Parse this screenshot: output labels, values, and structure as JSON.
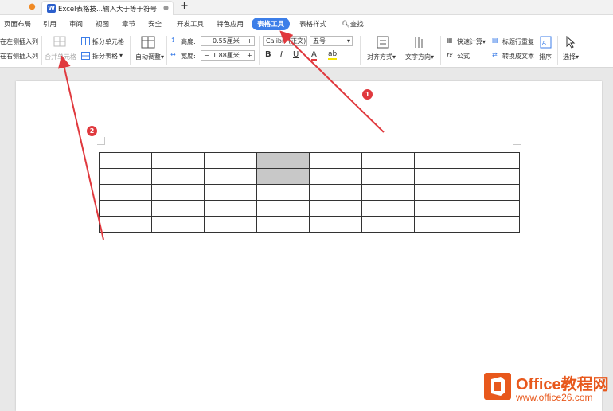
{
  "tabbar": {
    "doc_title": "Excel表格技...输入大于等于符号",
    "new_tab": "+",
    "app_letter": "W"
  },
  "menu": {
    "items": [
      "页面布局",
      "引用",
      "审阅",
      "视图",
      "章节",
      "安全",
      "开发工具",
      "特色应用",
      "表格工具",
      "表格样式"
    ],
    "active": "表格工具",
    "search": "查找"
  },
  "ribbon": {
    "insert_left_col": "在左侧插入列",
    "insert_right_col": "在右侧插入列",
    "merge_cells": "合并单元格",
    "split_cells": "拆分单元格",
    "split_table": "拆分表格",
    "auto_adjust": "自动调整",
    "height_label": "高度:",
    "height_value": "0.55厘米",
    "width_label": "宽度:",
    "width_value": "1.88厘米",
    "font_name": "Calibri (正文)",
    "font_size": "五号",
    "bold": "B",
    "italic": "I",
    "underline": "U",
    "font_color": "A",
    "highlight": "ab",
    "align": "对齐方式",
    "text_dir": "文字方向",
    "quick_calc": "快速计算",
    "formula": "公式",
    "fx": "fx",
    "repeat_header": "标题行重复",
    "to_text": "转换成文本",
    "sort": "排序",
    "select": "选择"
  },
  "table": {
    "rows": 5,
    "cols": 8,
    "shaded": [
      [
        0,
        3
      ],
      [
        1,
        3
      ]
    ]
  },
  "annotations": {
    "badge1": "1",
    "badge2": "2",
    "arrow_color": "#e0393e"
  },
  "watermark": {
    "line1": "Office教程网",
    "line2": "www.office26.com"
  },
  "colors": {
    "accent": "#3c7ee8",
    "brand": "#e8581c"
  }
}
